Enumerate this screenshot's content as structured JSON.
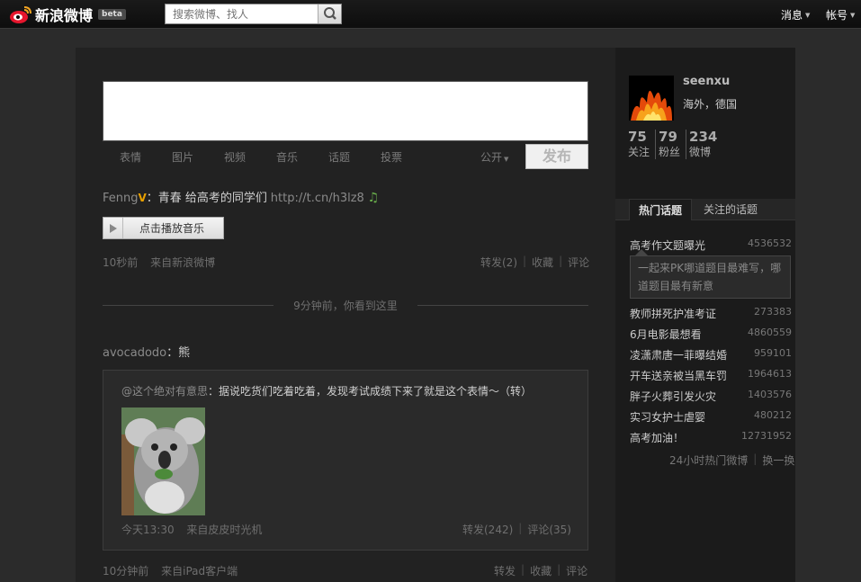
{
  "header": {
    "logo_text": "新浪微博",
    "beta": "beta",
    "search_placeholder": "搜索微博、找人",
    "nav_messages": "消息",
    "nav_account": "帐号"
  },
  "composer": {
    "tools": [
      "表情",
      "图片",
      "视频",
      "音乐",
      "话题",
      "投票"
    ],
    "visibility": "公开",
    "publish_label": "发布"
  },
  "feed": {
    "post1": {
      "author": "Fenng",
      "verified": "V",
      "content": "：青春 给高考的同学们",
      "link": "http://t.cn/h3lz8",
      "play_label": "点击播放音乐",
      "time": "10秒前",
      "source": "来自新浪微博",
      "repost": "转发(2)",
      "favorite": "收藏",
      "comment": "评论"
    },
    "divider_text": "9分钟前，你看到这里",
    "post2": {
      "author": "avocadodo",
      "content": "：熊",
      "retweet": {
        "origin": "@这个绝对有意思",
        "text": "：据说吃货们吃着吃着，发现考试成绩下来了就是这个表情～（转）",
        "time": "今天13:30",
        "source": "来自皮皮时光机",
        "repost": "转发(242)",
        "comment": "评论(35)"
      },
      "time": "10分钟前",
      "source": "来自iPad客户端",
      "repost": "转发",
      "favorite": "收藏",
      "comment": "评论"
    }
  },
  "profile": {
    "name": "seenxu",
    "location": "海外，德国",
    "stats": [
      {
        "num": "75",
        "label": "关注"
      },
      {
        "num": "79",
        "label": "粉丝"
      },
      {
        "num": "234",
        "label": "微博"
      }
    ]
  },
  "topics": {
    "tab_hot": "热门话题",
    "tab_follow": "关注的话题",
    "tip": "一起来PK哪道题目最难写，哪道题目最有新意",
    "items": [
      {
        "title": "高考作文题曝光",
        "count": "4536532"
      },
      {
        "title": "教师拼死护准考证",
        "count": "273383"
      },
      {
        "title": "6月电影最想看",
        "count": "4860559"
      },
      {
        "title": "凌潇肃唐一菲曝结婚",
        "count": "959101"
      },
      {
        "title": "开车送亲被当黑车罚",
        "count": "1964613"
      },
      {
        "title": "胖子火葬引发火灾",
        "count": "1403576"
      },
      {
        "title": "实习女护士虐婴",
        "count": "480212"
      },
      {
        "title": "高考加油！",
        "count": "12731952"
      }
    ],
    "footer_hot": "24小时热门微博",
    "footer_refresh": "换一换"
  }
}
